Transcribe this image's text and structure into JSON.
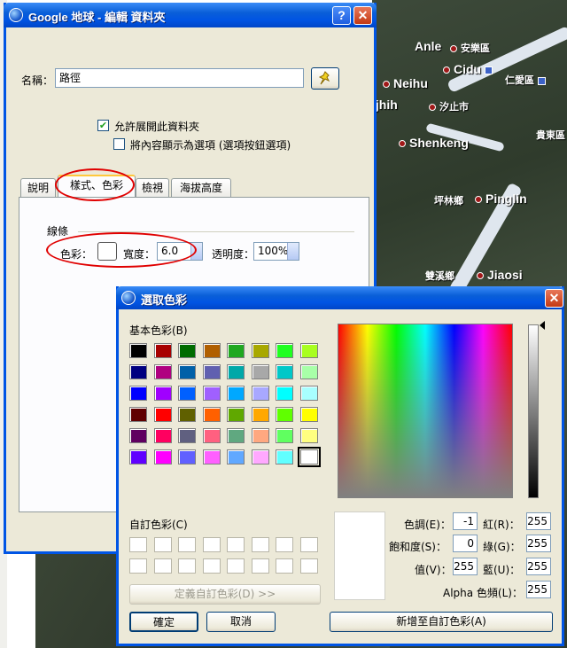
{
  "main_dialog": {
    "title": "Google 地球 - 編輯 資料夾",
    "help_label": "?",
    "close_label": "✕",
    "name_label": "名稱：",
    "name_value": "路徑",
    "pin_icon": "pushpin-icon",
    "allow_expand_label": "允許展開此資料夾",
    "allow_expand_checked": true,
    "show_contents_label": "將內容顯示為選項 (選項按鈕選項)",
    "show_contents_checked": false,
    "tabs": [
      "說明",
      "樣式、色彩",
      "檢視",
      "海拔高度"
    ],
    "active_tab": 1,
    "group_label": "線條",
    "color_label": "色彩：",
    "width_label": "寬度：",
    "width_value": "6.0",
    "opacity_label": "透明度：",
    "opacity_value": "100%"
  },
  "color_dialog": {
    "title": "選取色彩",
    "close_label": "✕",
    "basic_colors_label": "基本色彩(B)",
    "basic_colors": [
      [
        "#000000",
        "#a80000",
        "#006c00",
        "#b05f00",
        "#20a820",
        "#a8a800",
        "#20ff20",
        "#a8ff20"
      ],
      [
        "#000080",
        "#b00080",
        "#0060a8",
        "#6060b0",
        "#00a8a8",
        "#a8a8a8",
        "#00c8c8",
        "#a8ffa8"
      ],
      [
        "#0000ff",
        "#a000ff",
        "#0060ff",
        "#a060ff",
        "#00a8ff",
        "#a8a8ff",
        "#00ffff",
        "#a8ffff"
      ],
      [
        "#600000",
        "#ff0000",
        "#606000",
        "#ff6000",
        "#60a800",
        "#ffa800",
        "#60ff00",
        "#ffff00"
      ],
      [
        "#600060",
        "#ff0060",
        "#606080",
        "#ff6080",
        "#60a880",
        "#ffa880",
        "#60ff60",
        "#ffff80"
      ],
      [
        "#6000ff",
        "#ff00ff",
        "#6060ff",
        "#ff60ff",
        "#60a8ff",
        "#ffa8ff",
        "#60ffff",
        "#ffffff"
      ]
    ],
    "custom_colors_label": "自訂色彩(C)",
    "define_custom_label": "定義自訂色彩(D) >>",
    "ok_label": "確定",
    "cancel_label": "取消",
    "add_custom_label": "新增至自訂色彩(A)",
    "hue_label": "色調(E)：",
    "hue_value": "-1",
    "sat_label": "飽和度(S)：",
    "sat_value": "0",
    "lum_label": "值(V)：",
    "lum_value": "255",
    "red_label": "紅(R)：",
    "red_value": "255",
    "green_label": "綠(G)：",
    "green_value": "255",
    "blue_label": "藍(U)：",
    "blue_value": "255",
    "alpha_label": "Alpha 色頻(L)：",
    "alpha_value": "255"
  },
  "map": {
    "places": [
      "Anle",
      "安樂區",
      "Cidu",
      "仁愛區",
      "Neihu",
      "ijhih",
      "汐止市",
      "Shenkeng",
      "貴東區",
      "坪林鄉",
      "Pinglin",
      "雙溪鄉",
      "Jiaosi"
    ]
  }
}
